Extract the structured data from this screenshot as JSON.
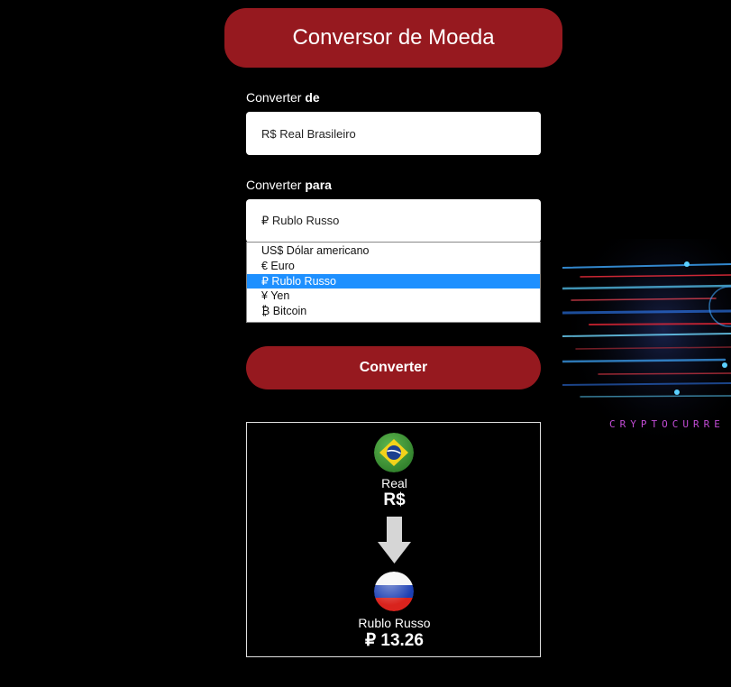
{
  "header": {
    "title": "Conversor de Moeda"
  },
  "from": {
    "label_prefix": "Converter ",
    "label_bold": "de",
    "selected": "R$ Real Brasileiro"
  },
  "to": {
    "label_prefix": "Converter ",
    "label_bold": "para",
    "selected": "₽ Rublo Russo",
    "options": [
      "US$ Dólar americano",
      "€ Euro",
      "₽ Rublo Russo",
      "¥ Yen",
      "₿ Bitcoin"
    ],
    "highlighted_index": 2
  },
  "convert_button": {
    "label": "Converter"
  },
  "result": {
    "source_name": "Real",
    "source_value": "R$",
    "target_name": "Rublo Russo",
    "target_value": "₽ 13.26",
    "source_flag_icon": "brazil-flag-icon",
    "target_flag_icon": "russia-flag-icon",
    "arrow_icon": "arrow-down-icon"
  },
  "background": {
    "banner_text": "CRYPTOCURRE"
  },
  "colors": {
    "accent": "#96191f",
    "highlight": "#1e90ff",
    "background": "#000000"
  }
}
